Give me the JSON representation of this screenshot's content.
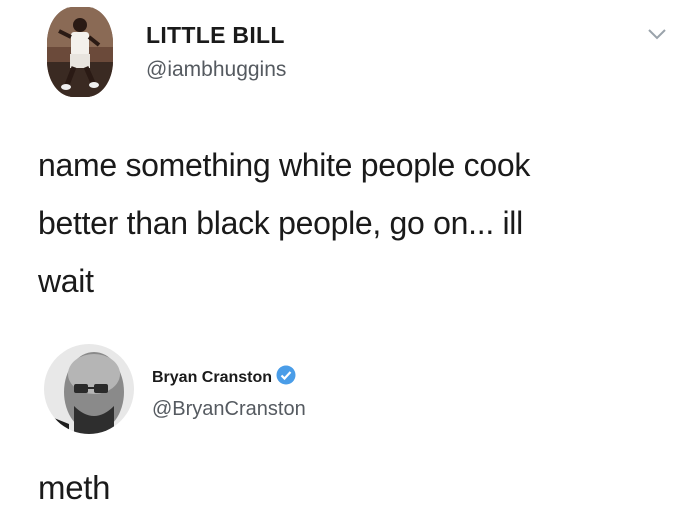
{
  "tweets": [
    {
      "display_name": "LITTLE BILL",
      "handle": "@iambhuggins",
      "text": "name something white people cook\nbetter than black people, go on... ill\nwait",
      "avatar_icon": "person-dancing-avatar",
      "menu_icon": "chevron-down-icon"
    },
    {
      "display_name": "Bryan Cranston",
      "handle": "@BryanCranston",
      "verified": true,
      "text": "meth",
      "avatar_icon": "bald-man-glasses-avatar",
      "verified_color": "#4a9de8"
    }
  ]
}
